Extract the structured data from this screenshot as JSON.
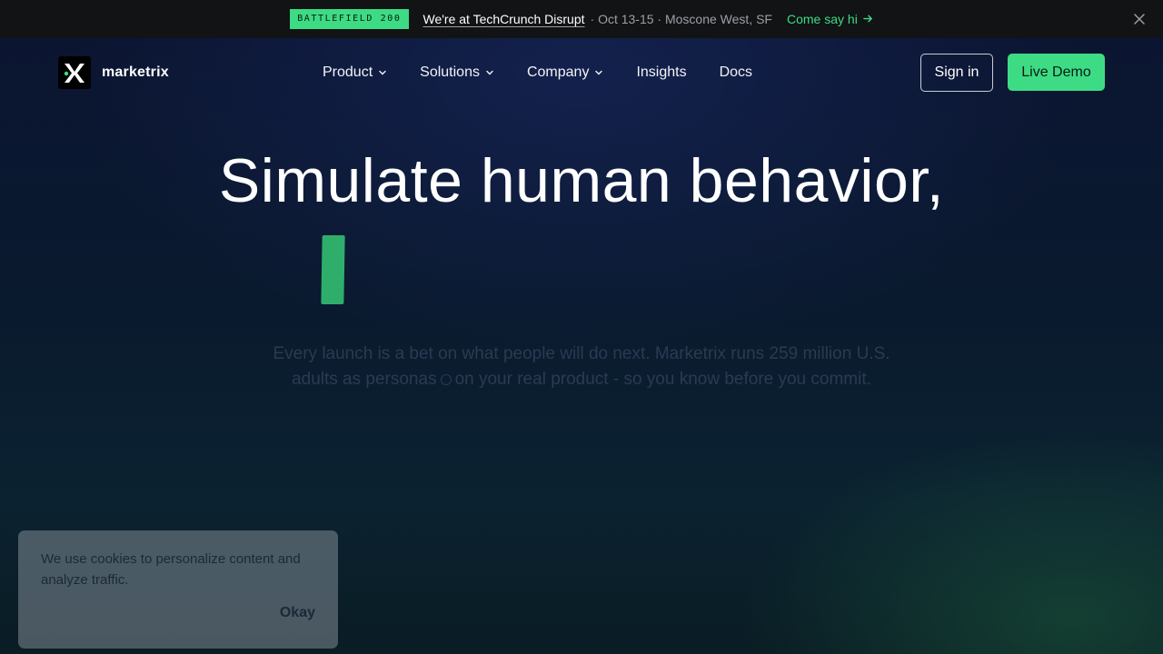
{
  "announcement": {
    "badge": "BATTLEFIELD 200",
    "event": "We're at TechCrunch Disrupt",
    "meta": "· Oct 13-15 · Moscone West, SF",
    "cta": "Come say hi",
    "cta_icon": "arrow-right-icon",
    "close_icon": "close-icon"
  },
  "nav": {
    "brand": "marketrix",
    "items": [
      {
        "label": "Product",
        "has_dropdown": true
      },
      {
        "label": "Solutions",
        "has_dropdown": true
      },
      {
        "label": "Company",
        "has_dropdown": true
      },
      {
        "label": "Insights",
        "has_dropdown": false
      },
      {
        "label": "Docs",
        "has_dropdown": false
      }
    ],
    "sign_in": "Sign in",
    "live_demo": "Live Demo"
  },
  "hero": {
    "headline": "Simulate human behavior,",
    "subtext_part1": "Every launch is a bet on what people will do next. Marketrix runs 259 million U.S. adults as personas",
    "subtext_part2": "on your real product - so you know before you commit."
  },
  "cookie": {
    "message": "We use cookies to personalize content and analyze traffic.",
    "ok": "Okay"
  },
  "colors": {
    "accent": "#3ddc84",
    "background": "#0a1228",
    "announce_bg": "#111315"
  }
}
